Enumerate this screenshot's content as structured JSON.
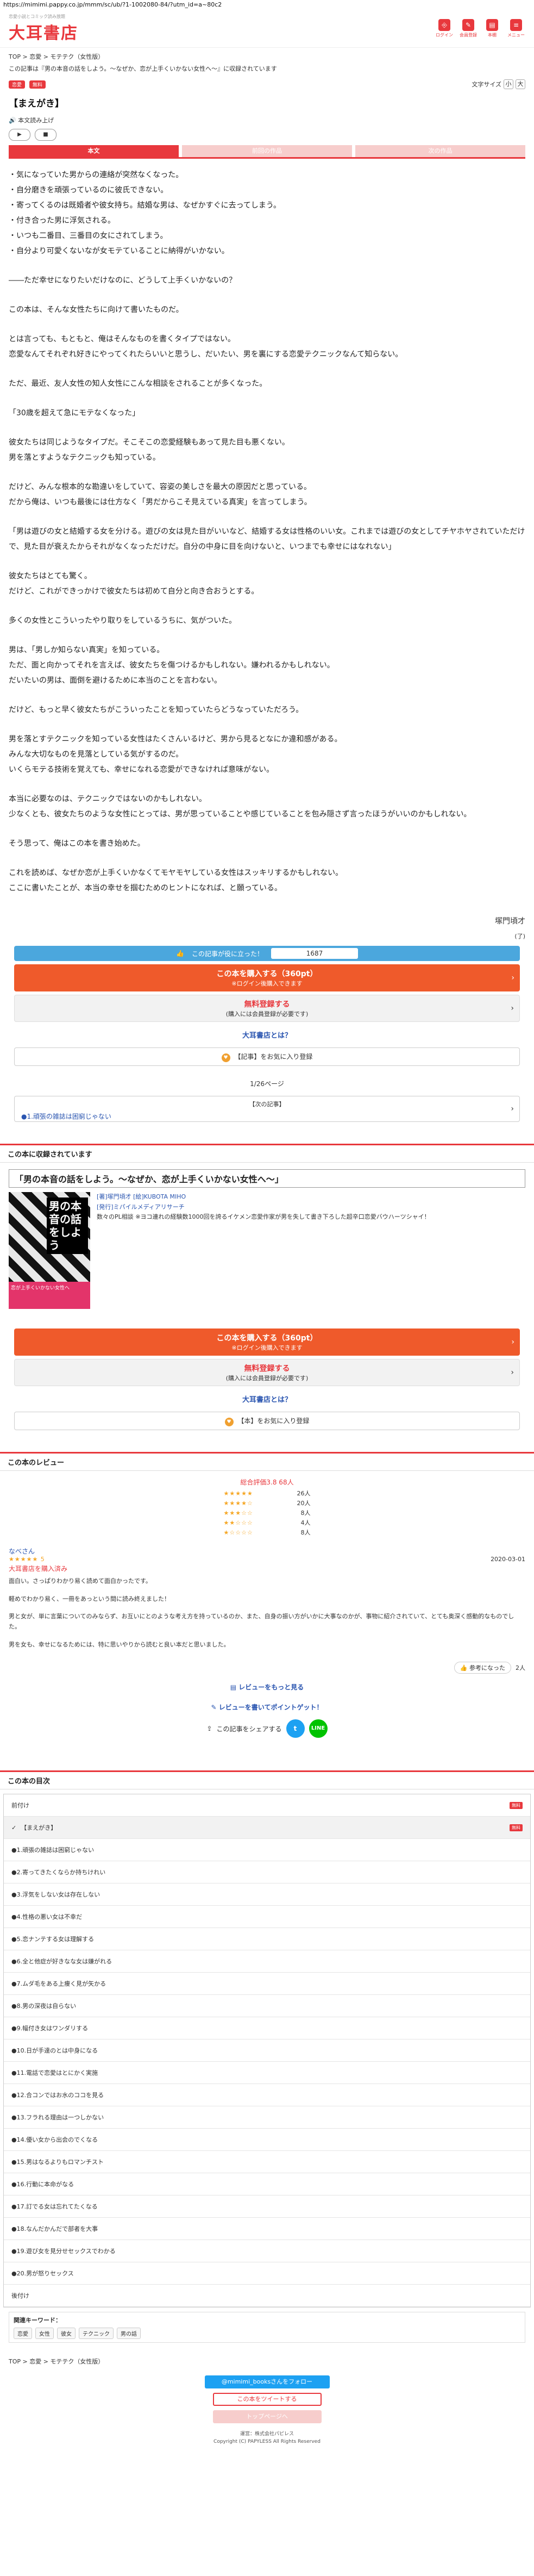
{
  "url": "https://mimimi.pappy.co.jp/mmm/sc/ub/?1-1002080-84/?utm_id=a~80c2",
  "header": {
    "tagline": "恋愛小説とコミック読み放題",
    "logo": "大耳書店",
    "icons": [
      {
        "name": "login-icon",
        "label": "ログイン",
        "glyph": "⎆"
      },
      {
        "name": "register-icon",
        "label": "会員登録",
        "glyph": "✎"
      },
      {
        "name": "bookshelf-icon",
        "label": "本棚",
        "glyph": "▤"
      },
      {
        "name": "menu-icon",
        "label": "メニュー",
        "glyph": "≡"
      }
    ]
  },
  "breadcrumb": "TOP > 恋愛 > モテテク（女性版）",
  "notice": "この記事は『男の本音の話をしよう。～なぜか、恋が上手くいかない女性へ～』に収録されています",
  "badges": [
    "恋愛",
    "無料"
  ],
  "font_size": {
    "label": "文字サイズ",
    "minus": "小",
    "plus": "大"
  },
  "story_title": "【まえがき】",
  "tts": {
    "label": "本文読み上げ",
    "play": "▶",
    "stop": "■"
  },
  "tabs": [
    "本文",
    "前回の作品",
    "次の作品"
  ],
  "body": [
    "・気になっていた男からの連絡が突然なくなった。\n・自分磨きを頑張っているのに彼氏できない。\n・寄ってくるのは既婚者や彼女持ち。結婚な男は、なぜかすぐに去ってしまう。\n・付き合った男に浮気される。\n・いつも二番目、三番目の女にされてしまう。\n・自分より可愛くないなが女モテていることに納得がいかない。",
    "――ただ幸せになりたいだけなのに、どうして上手くいかないの？",
    "この本は、そんな女性たちに向けて書いたものだ。",
    "とは言っても、もともと、俺はそんなものを書くタイプではない。\n恋愛なんてそれぞれ好きにやってくれたらいいと思うし、だいたい、男を裏にする恋愛テクニックなんて知らない。",
    "ただ、最近、友人女性の知人女性にこんな相談をされることが多くなった。",
    "「30歳を超えて急にモテなくなった」",
    "彼女たちは同じようなタイプだ。そこそこの恋愛経験もあって見た目も悪くない。\n男を落とすようなテクニックも知っている。",
    "だけど、みんな根本的な勘違いをしていて、容姿の美しさを最大の原因だと思っている。\nだから俺は、いつも最後には仕方なく「男だからこそ見えている真実」を言ってしまう。",
    "「男は遊びの女と結婚する女を分ける。遊びの女は見た目がいいなど、結婚する女は性格のいい女。これまでは遊びの女としてチヤホヤされていただけで、見た目が衰えたからそれがなくなっただけだ。自分の中身に目を向けないと、いつまでも幸せにはなれない」",
    "彼女たちはとても驚く。\nだけど、これができっかけで彼女たちは初めて自分と向き合おうとする。",
    "多くの女性とこういったやり取りをしているうちに、気がついた。",
    "男は、「男しか知らない真実」を知っている。\nただ、面と向かってそれを言えば、彼女たちを傷つけるかもしれない。嫌われるかもしれない。\nだいたいの男は、面倒を避けるために本当のことを言わない。",
    "だけど、もっと早く彼女たちがこういったことを知っていたらどうなっていただろう。",
    "男を落とすテクニックを知っている女性はたくさんいるけど、男から見るとなにか違和感がある。\nみんな大切なものを見落としている気がするのだ。\nいくらモテる技術を覚えても、幸せになれる恋愛ができなければ意味がない。",
    "本当に必要なのは、テクニックではないのかもしれない。\n少なくとも、彼女たちのような女性にとっては、男が思っていることや感じていることを包み隠さず言ったほうがいいのかもしれない。",
    "そう思って、俺はこの本を書き始めた。",
    "これを読めば、なぜか恋が上手くいかなくてモヤモヤしている女性はスッキリするかもしれない。\nここに書いたことが、本当の幸せを掴むためのヒントになれば、と願っている。"
  ],
  "author": "塚門頃才",
  "paren_note": "(了)",
  "like": {
    "label": "この記事が役に立った！",
    "count": "1687"
  },
  "buy": {
    "line1": "この本を購入する（360pt）",
    "line2": "※ログイン後購入できます"
  },
  "trial": {
    "line1": "無料登録する",
    "line2": "(購入には会員登録が必要です)"
  },
  "what_link": "大耳書店とは？",
  "fav_article": "【記事】をお気に入り登録",
  "fav_book": "【本】をお気に入り登録",
  "pager": "1/26ページ",
  "prev": {
    "heading": "【次の記事】",
    "title": "●1.頑張の雑誌は困窮じゃない"
  },
  "collection": {
    "section_title": "この本に収録されています",
    "title": "「男の本音の話をしよう。～なぜか、恋が上手くいかない女性へ～」",
    "cover_title": "男の本音の話をしよう",
    "cover_strip": "恋が上手くいかない女性へ",
    "author_line": "[著]塚門頃才 [絵]KUBOTA MIHO",
    "publisher_line": "[発行]ミパイルメディアリサーチ",
    "description": "数々のPL相談 ※ヨコ連れの経験数1000回を誇るイケメン恋愛作家が男を失して書き下ろした超辛口恋愛バウハーツシャイ！"
  },
  "reviews": {
    "section_title": "この本のレビュー",
    "summary": "総合評価3.8 68人",
    "rows": [
      {
        "stars": "★★★★★",
        "count": "26人"
      },
      {
        "stars": "★★★★☆",
        "count": "20人"
      },
      {
        "stars": "★★★☆☆",
        "count": "8人"
      },
      {
        "stars": "★★☆☆☆",
        "count": "4人"
      },
      {
        "stars": "★☆☆☆☆",
        "count": "8人"
      }
    ],
    "reviewer": "なべさん",
    "date": "2020-03-01",
    "review_stars": "★★★★★ 5",
    "review_title": "大耳書店を購入済み",
    "review_body": [
      "面白い。さっぱりわかり易く読めて面白かったです。",
      "軽めでわかり易く、一冊をあっという間に読み終えました！",
      "男と女が、単に言葉についてのみならず、お互いにとのような考え方を持っているのか、また、自身の振い方がいかに大事なのかが、事物に紹介されていて、とても奥深く感動的なものでした。",
      "男を女も、幸せになるためには、特に思いやりから読むと良い本だと思いました。"
    ],
    "helpful_label": "参考になった",
    "helpful_count": "2人",
    "more_link": "レビューをもっと見る",
    "write_link": "レビューを書いてポイントゲット！",
    "share_label": "この記事をシェアする",
    "share_twitter": "t",
    "share_line": "LINE"
  },
  "toc": {
    "section_title": "この本の目次",
    "free_label": "無料",
    "top_label": "前付け",
    "current": "【まえがき】",
    "items": [
      "●1.頑張の雑誌は困窮じゃない",
      "●2.寄ってきたくならか持ちけれい",
      "●3.浮気をしない女は存在しない",
      "●4.性格の悪い女は不幸だ",
      "●5.恋ナンテする女は理解する",
      "●6.全と他症が好きなな女は嫌がれる",
      "●7.ムダ毛をある上痩く見が矢かる",
      "●8.男の深夜は自らない",
      "●9.幅付き女はワンダリする",
      "●10.日が手達のとは中身になる",
      "●11.電話で恋愛はとにかく実施",
      "●12.合コンではお水のココを見る",
      "●13.フラれる理由は一つしかない",
      "●14.優い女から出会のでくなる",
      "●15.男はなるよりもロマンチスト",
      "●16.行動に本命がなる",
      "●17.訂でる女は忘れてたくなる",
      "●18.なんだかんだで部者を大事",
      "●19.遊び女を見分せセックスでわかる",
      "●20.男が怒りセックス"
    ],
    "bottom_label": "後付け"
  },
  "keywords": {
    "title": "関連キーワード：",
    "items": [
      "恋愛",
      "女性",
      "彼女",
      "テクニック",
      "男の話"
    ]
  },
  "bottom_breadcrumb": "TOP > 恋愛 > モテテク（女性版）",
  "follow": "@mimimi_booksさんをフォロー",
  "tweet": "この本をツイートする",
  "top_btn": "トップページへ",
  "footer": {
    "line1": "運営：株式会社パピレス",
    "line2": "Copyright (C) PAPYLESS All Rights Reserved"
  }
}
